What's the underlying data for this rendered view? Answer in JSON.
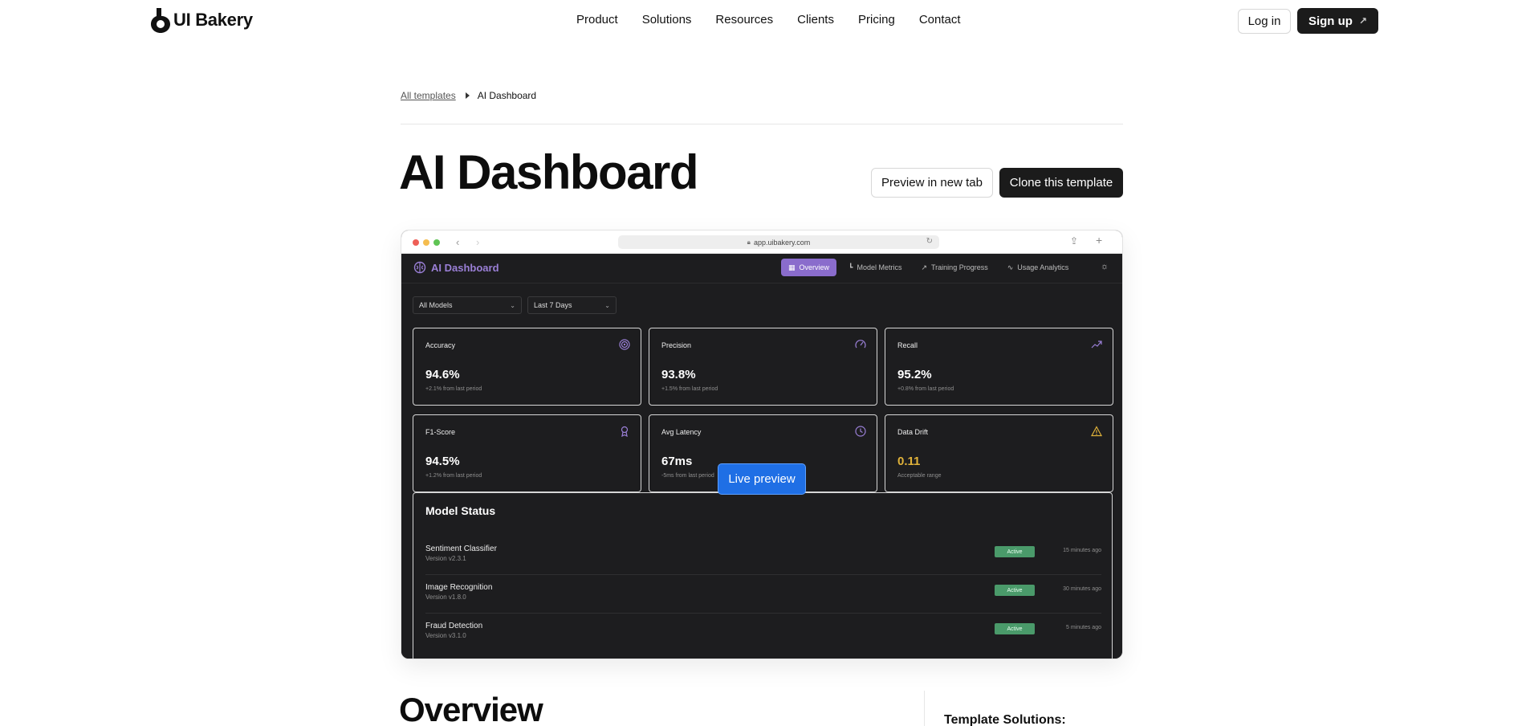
{
  "header": {
    "brand": "UI Bakery",
    "menu": [
      "Product",
      "Solutions",
      "Resources",
      "Clients",
      "Pricing",
      "Contact"
    ],
    "login_label": "Log in",
    "signup_label": "Sign up"
  },
  "breadcrumb": {
    "parent": "All templates",
    "current": "AI Dashboard"
  },
  "page": {
    "title": "AI Dashboard",
    "preview_label": "Preview in new tab",
    "clone_label": "Clone this template",
    "live_preview_label": "Live preview",
    "overview_heading": "Overview",
    "solutions_heading": "Template Solutions:"
  },
  "browser": {
    "url": "app.uibakery.com"
  },
  "app": {
    "brand": "AI Dashboard",
    "tabs": [
      {
        "label": "Overview",
        "icon": "grid-icon",
        "active": true
      },
      {
        "label": "Model Metrics",
        "icon": "bar-chart-icon",
        "active": false
      },
      {
        "label": "Training Progress",
        "icon": "trend-icon",
        "active": false
      },
      {
        "label": "Usage Analytics",
        "icon": "activity-icon",
        "active": false
      }
    ],
    "filters": {
      "model": "All Models",
      "range": "Last 7 Days"
    },
    "cards": [
      {
        "title": "Accuracy",
        "value": "94.6%",
        "sub": "+2.1% from last period",
        "icon": "target-icon"
      },
      {
        "title": "Precision",
        "value": "93.8%",
        "sub": "+1.5% from last period",
        "icon": "gauge-icon"
      },
      {
        "title": "Recall",
        "value": "95.2%",
        "sub": "+0.8% from last period",
        "icon": "trending-up-icon"
      },
      {
        "title": "F1-Score",
        "value": "94.5%",
        "sub": "+1.2% from last period",
        "icon": "award-icon"
      },
      {
        "title": "Avg Latency",
        "value": "67ms",
        "sub": "-5ms from last period",
        "icon": "clock-icon"
      },
      {
        "title": "Data Drift",
        "value": "0.11",
        "sub": "Acceptable range",
        "icon": "warning-icon"
      }
    ],
    "model_status": {
      "title": "Model Status",
      "rows": [
        {
          "name": "Sentiment Classifier",
          "version": "Version v2.3.1",
          "status": "Active",
          "time": "15 minutes ago"
        },
        {
          "name": "Image Recognition",
          "version": "Version v1.8.0",
          "status": "Active",
          "time": "30 minutes ago"
        },
        {
          "name": "Fraud Detection",
          "version": "Version v3.1.0",
          "status": "Active",
          "time": "5 minutes ago"
        }
      ]
    }
  },
  "colors": {
    "accent_purple": "#8a6ccc",
    "warning_yellow": "#e0b23a",
    "active_green": "#4a9a6a",
    "cta_blue": "#1f6fe5"
  }
}
